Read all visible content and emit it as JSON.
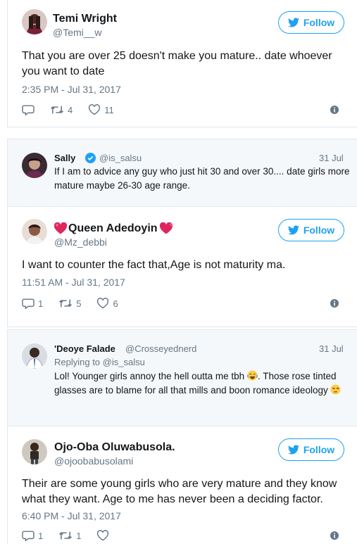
{
  "tweets": [
    {
      "name": "Temi Wright",
      "handle": "@Temi__w",
      "follow_label": "Follow",
      "text": "That you are over 25 doesn't make you mature.. date whoever you want to date",
      "timestamp": "2:35 PM - Jul 31, 2017",
      "retweets": "4",
      "likes": "11"
    },
    {
      "name": "Queen Adedoyin",
      "handle": "@Mz_debbi",
      "follow_label": "Follow",
      "text": "I want to counter the fact that,Age is not maturity ma.",
      "timestamp": "11:51 AM - Jul 31, 2017",
      "replies": "1",
      "retweets": "5",
      "likes": "6"
    },
    {
      "name": "Ojo-Oba Oluwabusola.",
      "handle": "@ojoobabusolami",
      "follow_label": "Follow",
      "text": "Their are some young girls who are very mature and they know what they want. Age to me has never been a deciding factor.",
      "timestamp": "6:40 PM - Jul 31, 2017",
      "replies": "1",
      "retweets": "1"
    }
  ],
  "quotes": [
    {
      "name": "Sally",
      "handle": "@is_salsu",
      "date": "31 Jul",
      "verified": true,
      "text": "If I am to advice any guy who just hit 30 and over 30.... date girls more mature maybe 26-30 age range."
    },
    {
      "name": "'Deoye Falade",
      "handle": "@Crosseyednerd",
      "date": "31 Jul",
      "reply_to": "Replying to @is_salsu",
      "text_part1": "Lol! Younger girls annoy the hell outta me tbh",
      "text_part2": ". Those rose tinted glasses are to blame for all that mills and boon romance ideology"
    }
  ],
  "colors": {
    "accent": "#1da1f2",
    "secondary_text": "#657786",
    "border": "#e1e8ed",
    "quote_bg": "#f5f8fa",
    "heart_emoji": "#e0245e"
  },
  "icons": [
    "twitter-bird-icon",
    "reply-icon",
    "retweet-icon",
    "like-icon",
    "info-icon",
    "verified-badge-icon",
    "heart-emoji-icon",
    "tears-of-joy-emoji-icon",
    "unamused-emoji-icon"
  ]
}
